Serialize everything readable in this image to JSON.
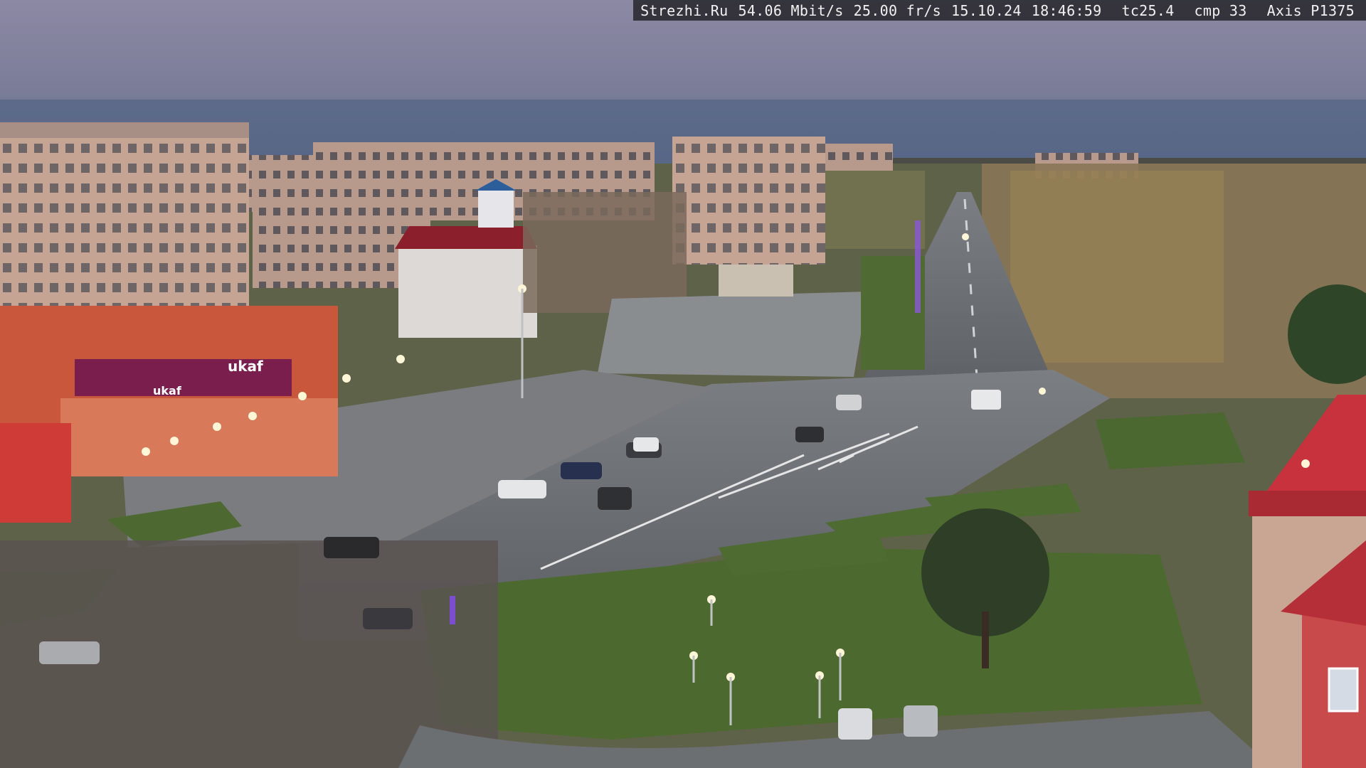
{
  "overlay": {
    "site": "Strezhi.Ru",
    "bitrate": "54.06 Mbit/s",
    "framerate": "25.00 fr/s",
    "date": "15.10.24",
    "time": "18:46:59",
    "tc": "tc25.4",
    "cmp": "cmp 33",
    "camera": "Axis P1375"
  },
  "signs": {
    "store_main": "ukaf",
    "store_left": "ukaf"
  },
  "colors": {
    "sky_top": "#8b8aa6",
    "sky_bottom": "#5f6a86",
    "road": "#6f7377",
    "grass": "#4f6a34",
    "brick_building": "#c9a795",
    "store_red": "#d0593c",
    "store_banner": "#7a1f4d",
    "tower_red": "#cf3a45"
  }
}
